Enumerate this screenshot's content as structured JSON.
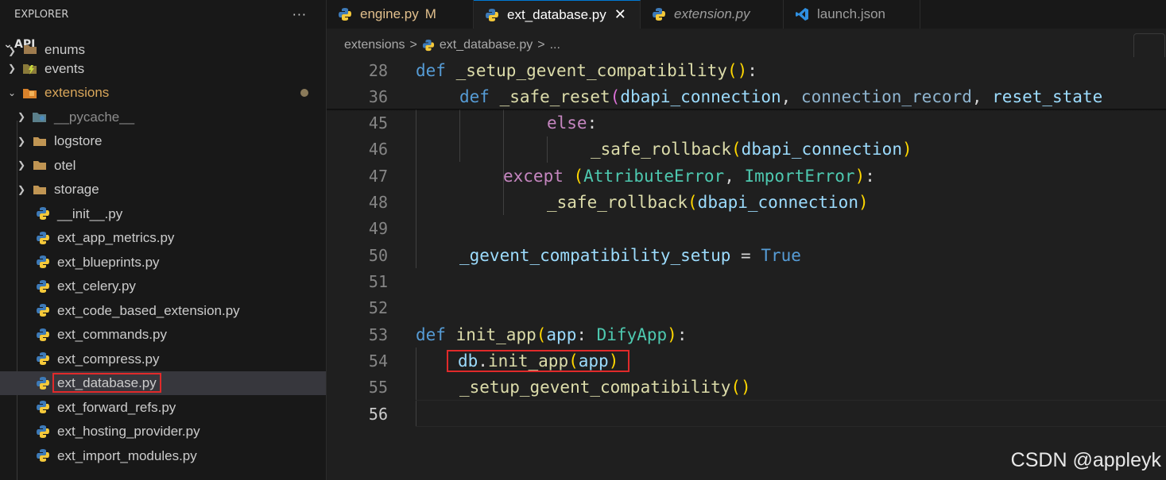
{
  "sidebar": {
    "title": "EXPLORER",
    "more": "···",
    "section": "API",
    "items": [
      {
        "label": "enums",
        "kind": "folder",
        "state": "collapsed"
      },
      {
        "label": "events",
        "kind": "folder",
        "state": "collapsed"
      },
      {
        "label": "extensions",
        "kind": "folder",
        "state": "expanded"
      },
      {
        "label": "__pycache__",
        "kind": "folder",
        "state": "collapsed"
      },
      {
        "label": "logstore",
        "kind": "folder",
        "state": "collapsed"
      },
      {
        "label": "otel",
        "kind": "folder",
        "state": "collapsed"
      },
      {
        "label": "storage",
        "kind": "folder",
        "state": "collapsed"
      },
      {
        "label": "__init__.py",
        "kind": "python"
      },
      {
        "label": "ext_app_metrics.py",
        "kind": "python"
      },
      {
        "label": "ext_blueprints.py",
        "kind": "python"
      },
      {
        "label": "ext_celery.py",
        "kind": "python"
      },
      {
        "label": "ext_code_based_extension.py",
        "kind": "python"
      },
      {
        "label": "ext_commands.py",
        "kind": "python"
      },
      {
        "label": "ext_compress.py",
        "kind": "python"
      },
      {
        "label": "ext_database.py",
        "kind": "python",
        "selected": true
      },
      {
        "label": "ext_forward_refs.py",
        "kind": "python"
      },
      {
        "label": "ext_hosting_provider.py",
        "kind": "python"
      },
      {
        "label": "ext_import_modules.py",
        "kind": "python"
      }
    ]
  },
  "tabs": [
    {
      "label": "engine.py",
      "badge": "M"
    },
    {
      "label": "ext_database.py",
      "close": "✕"
    },
    {
      "label": "extension.py"
    },
    {
      "label": "launch.json"
    }
  ],
  "breadcrumb": {
    "folder": "extensions",
    "sep": ">",
    "file": "ext_database.py",
    "rest": "..."
  },
  "editor": {
    "line_numbers": [
      "28",
      "36",
      "45",
      "46",
      "47",
      "48",
      "49",
      "50",
      "51",
      "52",
      "53",
      "54",
      "55",
      "56"
    ],
    "tokens": {
      "def": "def",
      "setup_fn": "_setup_gevent_compatibility",
      "safe_reset": "_safe_reset",
      "dbapi": "dbapi_connection",
      "conn_record": "connection_record",
      "reset_state": "reset_state",
      "else": "else",
      "safe_rollback": "_safe_rollback",
      "except": "except",
      "attr_err": "AttributeError",
      "import_err": "ImportError",
      "setup_flag": "_gevent_compatibility_setup",
      "true": "True",
      "init_app": "init_app",
      "app": "app",
      "dify_app": "DifyApp",
      "db": "db"
    }
  },
  "colors": {
    "accent": "#0078d4",
    "highlight_box": "#e02a2a",
    "modified": "#e2c08d"
  },
  "watermark": "CSDN @appleyk"
}
